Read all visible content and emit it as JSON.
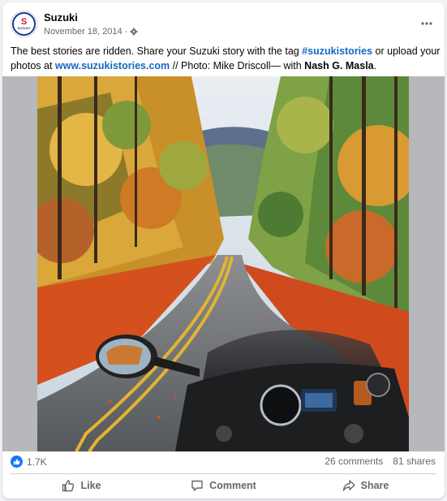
{
  "post": {
    "page_name": "Suzuki",
    "date": "November 18, 2014",
    "separator": "·",
    "avatar": {
      "letter": "S",
      "word": "SUZUKI"
    },
    "caption": {
      "part1": "The best stories are ridden. Share your Suzuki story with the tag ",
      "hashtag": "#suzukistories",
      "part2": " or upload your photos at ",
      "link": "www.suzukistories.com",
      "part3": " // Photo: Mike Driscoll— with ",
      "tagged_person": "Nash G. Masla",
      "part4": "."
    },
    "photo_icon": "autumn-road-motorcycle-photo"
  },
  "stats": {
    "reactions_count": "1.7K",
    "comments": "26 comments",
    "shares": "81 shares"
  },
  "actions": {
    "like": "Like",
    "comment": "Comment",
    "share": "Share"
  },
  "colors": {
    "link": "#1667c1",
    "like_blue": "#1877f2",
    "secondary_text": "#65676b",
    "brand_red": "#d7131d",
    "brand_blue": "#1a3a8f"
  }
}
